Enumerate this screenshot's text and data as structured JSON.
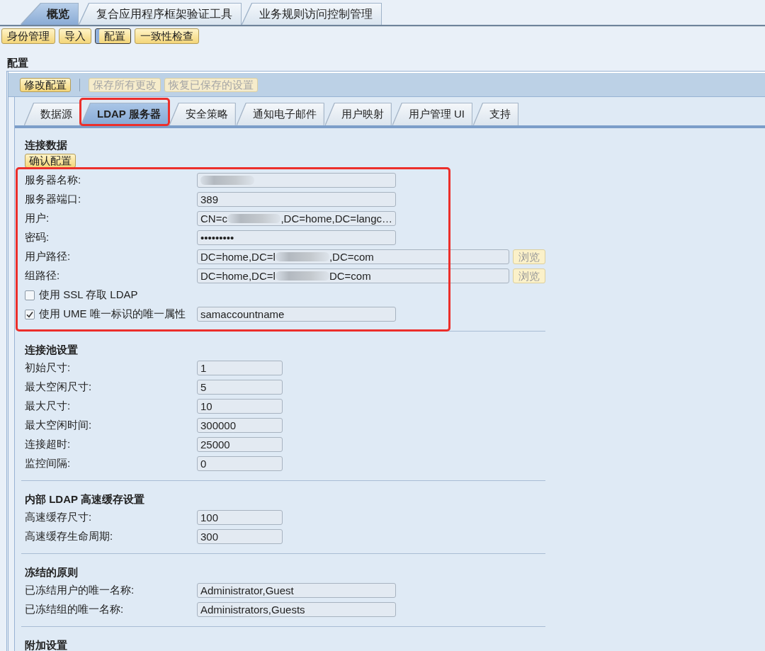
{
  "top_tabs": [
    {
      "label": "概览",
      "selected": true
    },
    {
      "label": "复合应用程序框架验证工具",
      "selected": false
    },
    {
      "label": "业务规则访问控制管理",
      "selected": false
    }
  ],
  "nav_buttons": [
    {
      "label": "身份管理",
      "selected": false
    },
    {
      "label": "导入",
      "selected": false
    },
    {
      "label": "配置",
      "selected": true
    },
    {
      "label": "一致性检查",
      "selected": false
    }
  ],
  "page_title": "配置",
  "toolbar": [
    {
      "kind": "button",
      "label": "修改配置",
      "disabled": false
    },
    {
      "kind": "separator"
    },
    {
      "kind": "button",
      "label": "保存所有更改",
      "disabled": true
    },
    {
      "kind": "button",
      "label": "恢复已保存的设置",
      "disabled": true
    }
  ],
  "tabs": [
    {
      "label": "数据源",
      "selected": false,
      "highlighted": false
    },
    {
      "label": "LDAP 服务器",
      "selected": true,
      "highlighted": true
    },
    {
      "label": "安全策略",
      "selected": false,
      "highlighted": false
    },
    {
      "label": "通知电子邮件",
      "selected": false,
      "highlighted": false
    },
    {
      "label": "用户映射",
      "selected": false,
      "highlighted": false
    },
    {
      "label": "用户管理 UI",
      "selected": false,
      "highlighted": false
    },
    {
      "label": "支持",
      "selected": false,
      "highlighted": false
    }
  ],
  "sections": [
    {
      "title": "连接数据",
      "button": "确认配置",
      "highlighted": true,
      "rows": [
        {
          "kind": "field",
          "label": "服务器名称:",
          "value_parts": [
            {
              "kind": "redacted"
            }
          ]
        },
        {
          "kind": "field",
          "label": "服务器端口:",
          "value": "389"
        },
        {
          "kind": "field",
          "label": "用户:",
          "value_parts": [
            {
              "kind": "text",
              "text": "CN=c"
            },
            {
              "kind": "redacted"
            },
            {
              "kind": "text",
              "text": ",DC=home,DC=langc…"
            }
          ]
        },
        {
          "kind": "field",
          "label": "密码:",
          "value": "•••••••••"
        },
        {
          "kind": "browse",
          "label": "用户路径:",
          "value_parts": [
            {
              "kind": "text",
              "text": "DC=home,DC=l"
            },
            {
              "kind": "redacted"
            },
            {
              "kind": "text",
              "text": ",DC=com"
            }
          ],
          "button": "浏览",
          "button_disabled": true
        },
        {
          "kind": "browse",
          "label": "组路径:",
          "value_parts": [
            {
              "kind": "text",
              "text": "DC=home,DC=l"
            },
            {
              "kind": "redacted"
            },
            {
              "kind": "text",
              "text": "DC=com"
            }
          ],
          "button": "浏览",
          "button_disabled": true
        },
        {
          "kind": "checkbox",
          "label": "使用 SSL 存取 LDAP",
          "checked": false
        },
        {
          "kind": "checkbox_field",
          "label": "使用 UME 唯一标识的唯一属性",
          "checked": true,
          "value": "samaccountname"
        }
      ]
    },
    {
      "title": "连接池设置",
      "highlighted": false,
      "rows": [
        {
          "kind": "number",
          "label": "初始尺寸:",
          "value": "1"
        },
        {
          "kind": "number",
          "label": "最大空闲尺寸:",
          "value": "5"
        },
        {
          "kind": "number",
          "label": "最大尺寸:",
          "value": "10"
        },
        {
          "kind": "number",
          "label": "最大空闲时间:",
          "value": "300000"
        },
        {
          "kind": "number",
          "label": "连接超时:",
          "value": "25000"
        },
        {
          "kind": "number",
          "label": "监控间隔:",
          "value": "0"
        }
      ]
    },
    {
      "title": "内部 LDAP 高速缓存设置",
      "highlighted": false,
      "rows": [
        {
          "kind": "number",
          "label": "高速缓存尺寸:",
          "value": "100"
        },
        {
          "kind": "number",
          "label": "高速缓存生命周期:",
          "value": "300"
        }
      ]
    },
    {
      "title": "冻结的原则",
      "highlighted": false,
      "rows": [
        {
          "kind": "field",
          "label": "已冻结用户的唯一名称:",
          "value": "Administrator,Guest"
        },
        {
          "kind": "field",
          "label": "已冻结组的唯一名称:",
          "value": "Administrators,Guests"
        }
      ]
    },
    {
      "title": "附加设置",
      "highlighted": false
    }
  ]
}
